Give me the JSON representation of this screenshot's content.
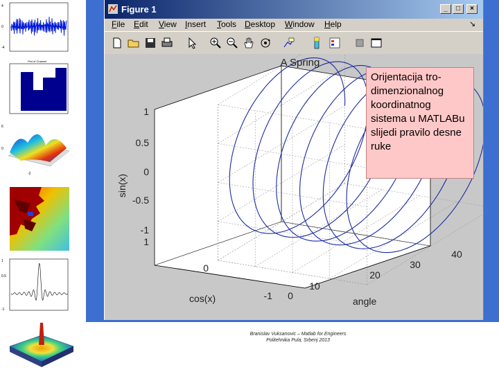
{
  "window": {
    "title": "Figure 1",
    "controls": {
      "minimize": "_",
      "maximize": "□",
      "close": "×"
    }
  },
  "menu": [
    {
      "label": "File",
      "key": "F"
    },
    {
      "label": "Edit",
      "key": "E"
    },
    {
      "label": "View",
      "key": "V"
    },
    {
      "label": "Insert",
      "key": "I"
    },
    {
      "label": "Tools",
      "key": "T"
    },
    {
      "label": "Desktop",
      "key": "D"
    },
    {
      "label": "Window",
      "key": "W"
    },
    {
      "label": "Help",
      "key": "H"
    }
  ],
  "toolbar_icons": [
    "new-file-icon",
    "open-folder-icon",
    "save-icon",
    "print-icon",
    "pointer-icon",
    "zoom-in-icon",
    "zoom-out-icon",
    "pan-hand-icon",
    "rotate-3d-icon",
    "data-cursor-icon",
    "colorbar-icon",
    "legend-icon",
    "hide-plot-tools-icon",
    "show-plot-tools-icon"
  ],
  "plot": {
    "title": "A Spring",
    "zlabel": "sin(x)",
    "ylabel": "cos(x)",
    "xlabel": "angle",
    "z_ticks": [
      "1",
      "0.5",
      "0",
      "-0.5",
      "-1"
    ],
    "y_ticks": [
      "1",
      "0",
      "-1"
    ],
    "x_ticks": [
      "0",
      "10",
      "20",
      "30",
      "40"
    ]
  },
  "chart_data": {
    "type": "line",
    "title": "A Spring",
    "xlabel": "angle",
    "ylabel": "cos(x)",
    "zlabel": "sin(x)",
    "series": [
      {
        "x": "t from 0 to ~40",
        "y": "cos(t)",
        "z": "sin(t)"
      }
    ],
    "xlim": [
      0,
      40
    ],
    "ylim": [
      -1,
      1
    ],
    "zlim": [
      -1,
      1
    ],
    "grid": true,
    "color": "#1a2aa0"
  },
  "note": "Orijentacija tro-dimenzionalnog koordinatnog sistema u MATLABu slijedi pravilo desne ruke",
  "caption": {
    "line1": "Branislav Vuksanovic – Matlab for Engineers",
    "line2": "Politehnika Pula, Srbenj 2013"
  },
  "colors": {
    "title_bar": "#0a246a",
    "figure_bg": "#d4d0c8",
    "plot_bg": "#c8c8c8",
    "note_bg": "#ffc8c8",
    "slide_border": "#3c6fcf"
  }
}
